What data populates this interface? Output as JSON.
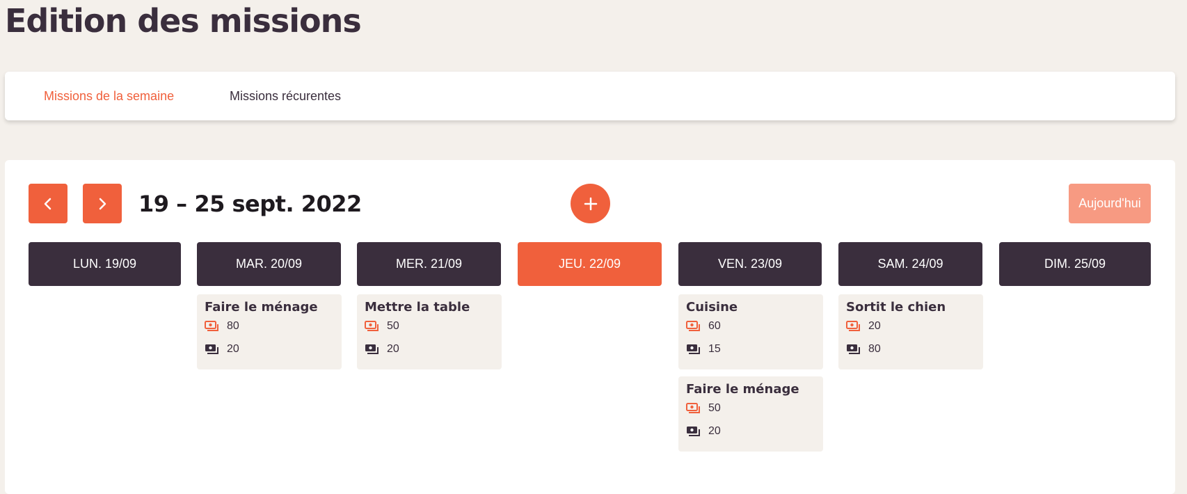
{
  "page": {
    "title": "Edition des missions"
  },
  "tabs": [
    {
      "label": "Missions de la semaine",
      "active": true
    },
    {
      "label": "Missions récurentes",
      "active": false
    }
  ],
  "calendar": {
    "week_label": "19 – 25 sept. 2022",
    "today_label": "Aujourd'hui",
    "prev_icon": "chevron-left-icon",
    "next_icon": "chevron-right-icon",
    "add_icon": "plus-icon",
    "days": [
      {
        "label": "LUN. 19/09",
        "today": false
      },
      {
        "label": "MAR. 20/09",
        "today": false
      },
      {
        "label": "MER. 21/09",
        "today": false
      },
      {
        "label": "JEU. 22/09",
        "today": true
      },
      {
        "label": "VEN. 23/09",
        "today": false
      },
      {
        "label": "SAM. 24/09",
        "today": false
      },
      {
        "label": "DIM. 25/09",
        "today": false
      }
    ],
    "missions": [
      {
        "day": "MAR. 20/09",
        "title": "Faire le ménage",
        "reward": "80",
        "cost": "20"
      },
      {
        "day": "MER. 21/09",
        "title": "Mettre la table",
        "reward": "50",
        "cost": "20"
      },
      {
        "day": "VEN. 23/09",
        "title": "Cuisine",
        "reward": "60",
        "cost": "15"
      },
      {
        "day": "VEN. 23/09",
        "title": "Faire le ménage",
        "reward": "50",
        "cost": "20"
      },
      {
        "day": "SAM. 24/09",
        "title": "Sortit le chien",
        "reward": "20",
        "cost": "80"
      }
    ]
  },
  "colors": {
    "accent": "#f0603c",
    "accent_light": "#f79a82",
    "dark": "#3a2e3d",
    "background": "#f4f0eb"
  }
}
